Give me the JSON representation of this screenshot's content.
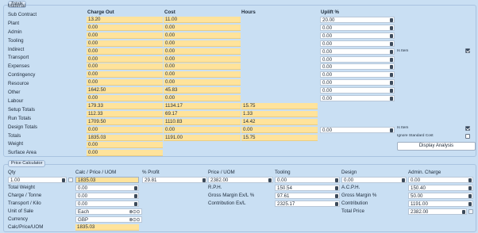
{
  "totals": {
    "legend": "Totals",
    "headers": {
      "charge_out": "Charge Out",
      "cost": "Cost",
      "hours": "Hours",
      "uplift": "Uplift %"
    },
    "rows": [
      {
        "label": "Material",
        "charge_out": "13.20",
        "cost": "11.00",
        "hours": null,
        "uplift": "20.00"
      },
      {
        "label": "Sub Contract",
        "charge_out": "0.00",
        "cost": "0.00",
        "hours": null,
        "uplift": "0.00"
      },
      {
        "label": "Plant",
        "charge_out": "0.00",
        "cost": "0.00",
        "hours": null,
        "uplift": "0.00"
      },
      {
        "label": "Admin",
        "charge_out": "0.00",
        "cost": "0.00",
        "hours": null,
        "uplift": "0.00"
      },
      {
        "label": "Tooling",
        "charge_out": "0.00",
        "cost": "0.00",
        "hours": null,
        "uplift": "0.00"
      },
      {
        "label": "Indirect",
        "charge_out": "0.00",
        "cost": "0.00",
        "hours": null,
        "uplift": "0.00"
      },
      {
        "label": "Transport",
        "charge_out": "0.00",
        "cost": "0.00",
        "hours": null,
        "uplift": "0.00"
      },
      {
        "label": "Expenses",
        "charge_out": "0.00",
        "cost": "0.00",
        "hours": null,
        "uplift": "0.00"
      },
      {
        "label": "Contingency",
        "charge_out": "0.00",
        "cost": "0.00",
        "hours": null,
        "uplift": "0.00"
      },
      {
        "label": "Resource",
        "charge_out": "1642.50",
        "cost": "45.83",
        "hours": null,
        "uplift": "0.00"
      },
      {
        "label": "Other",
        "charge_out": "0.00",
        "cost": "0.00",
        "hours": null,
        "uplift": "0.00"
      },
      {
        "label": "Labour",
        "charge_out": "179.33",
        "cost": "1134.17",
        "hours": "15.75",
        "uplift": null
      },
      {
        "label": "Setup Totals",
        "charge_out": "112.33",
        "cost": "69.17",
        "hours": "1.33",
        "uplift": null
      },
      {
        "label": "Run Totals",
        "charge_out": "1709.50",
        "cost": "1110.83",
        "hours": "14.42",
        "uplift": null
      },
      {
        "label": "Design Totals",
        "charge_out": "0.00",
        "cost": "0.00",
        "hours": "0.00",
        "uplift": "0.00"
      },
      {
        "label": "Totals",
        "charge_out": "1835.03",
        "cost": "1191.00",
        "hours": "15.75",
        "uplift": null
      },
      {
        "label": "Weight",
        "charge_out": "0.00",
        "cost": null,
        "hours": null,
        "uplift": null
      },
      {
        "label": "Surface Area",
        "charge_out": "0.00",
        "cost": null,
        "hours": null,
        "uplift": null
      }
    ],
    "is_item_tooling_label": "Is Item",
    "is_item_tooling_checked": true,
    "is_item_design_label": "Is Item",
    "is_item_design_checked": true,
    "ignore_standard_cost_label": "Ignore Standard Cost",
    "ignore_standard_cost_checked": false,
    "display_analysis_button": "Display Analysis"
  },
  "price_calculator": {
    "legend": "Price Calculator",
    "col1": {
      "qty_label": "Qty",
      "qty_value": "1.00",
      "total_weight_label": "Total Weight",
      "charge_tonne_label": "Charge / Tonne",
      "transport_kilo_label": "Transport / Kilo",
      "unit_of_sale_label": "Unit of Sale",
      "currency_label": "Currency",
      "calc_price_uom_label": "Calc/Price/UOM"
    },
    "col2": {
      "header": "Calc / Price / UOM",
      "calc_price_value": "1835.03",
      "total_weight_value": "0.00",
      "charge_tonne_value": "0.00",
      "transport_kilo_value": "0.00",
      "unit_of_sale_value": "Each",
      "currency_value": "GBP",
      "calc_price_uom_value": "1835.03"
    },
    "col3": {
      "profit_header": "% Profit",
      "profit_value": "29.81",
      "rph_label": "R.P.H.",
      "gm_ex_label": "Gross Margin Ex/L %",
      "contribution_ex_label": "Contribution Ex/L"
    },
    "col4": {
      "price_uom_header": "Price / UOM",
      "price_uom_value": "2382.00",
      "rph_value": "150.54",
      "gm_ex_value": "97.61",
      "contribution_ex_value": "2325.17"
    },
    "col5": {
      "tooling_header": "Tooling",
      "tooling_value": "0.00",
      "acph_label": "A.C.P.H.",
      "gm_label": "Gross Margin %",
      "contribution_label": "Contribution",
      "total_price_label": "Total Price"
    },
    "col6": {
      "design_header": "Design",
      "design_value": "0.00"
    },
    "col7": {
      "admin_header": "Admin. Charge",
      "admin_value": "0.00",
      "acph_value": "150.40",
      "gm_value": "50.00",
      "contribution_value": "1191.00",
      "total_price_value": "2382.00"
    }
  }
}
